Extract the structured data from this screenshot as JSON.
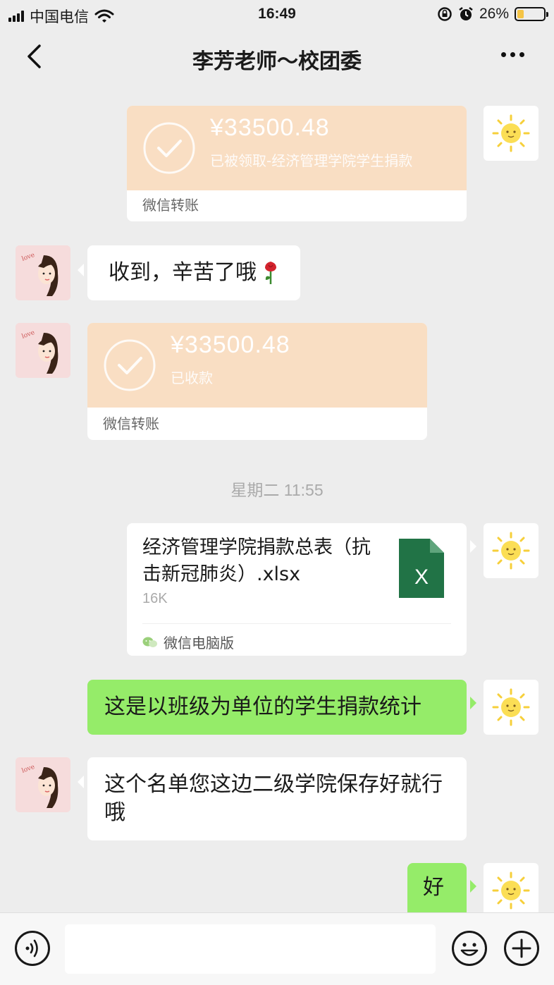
{
  "status_bar": {
    "carrier": "中国电信",
    "time": "16:49",
    "battery_percent": "26%",
    "battery_level": 0.26,
    "icons": [
      "signal-icon",
      "wifi-icon",
      "orientation-lock-icon",
      "alarm-icon",
      "battery-icon"
    ]
  },
  "nav": {
    "title": "李芳老师～校团委",
    "back_icon": "chevron-left-icon",
    "more_icon": "more-dots-icon"
  },
  "messages": {
    "m1": {
      "amount": "¥33500.48",
      "status": "已被领取-经济管理学院学生捐款",
      "footer": "微信转账"
    },
    "m2": {
      "text": "收到，辛苦了哦",
      "emoji": "rose-icon"
    },
    "m3": {
      "amount": "¥33500.48",
      "status": "已收款",
      "footer": "微信转账"
    },
    "timestamp": "星期二 11:55",
    "m4": {
      "file_name": "经济管理学院捐款总表（抗击新冠肺炎）.xlsx",
      "file_size": "16K",
      "source": "微信电脑版",
      "file_icon_letter": "X"
    },
    "m5": {
      "text": "这是以班级为单位的学生捐款统计"
    },
    "m6": {
      "text": "这个名单您这边二级学院保存好就行哦"
    },
    "m7": {
      "text": "好"
    }
  },
  "input_bar": {
    "voice_icon": "voice-icon",
    "emoji_icon": "emoji-icon",
    "plus_icon": "plus-icon",
    "placeholder": ""
  },
  "colors": {
    "background": "#ededed",
    "sent_bubble": "#95ec69",
    "received_bubble": "#ffffff",
    "transfer_card": "#f9dec3",
    "excel_green": "#217346"
  }
}
